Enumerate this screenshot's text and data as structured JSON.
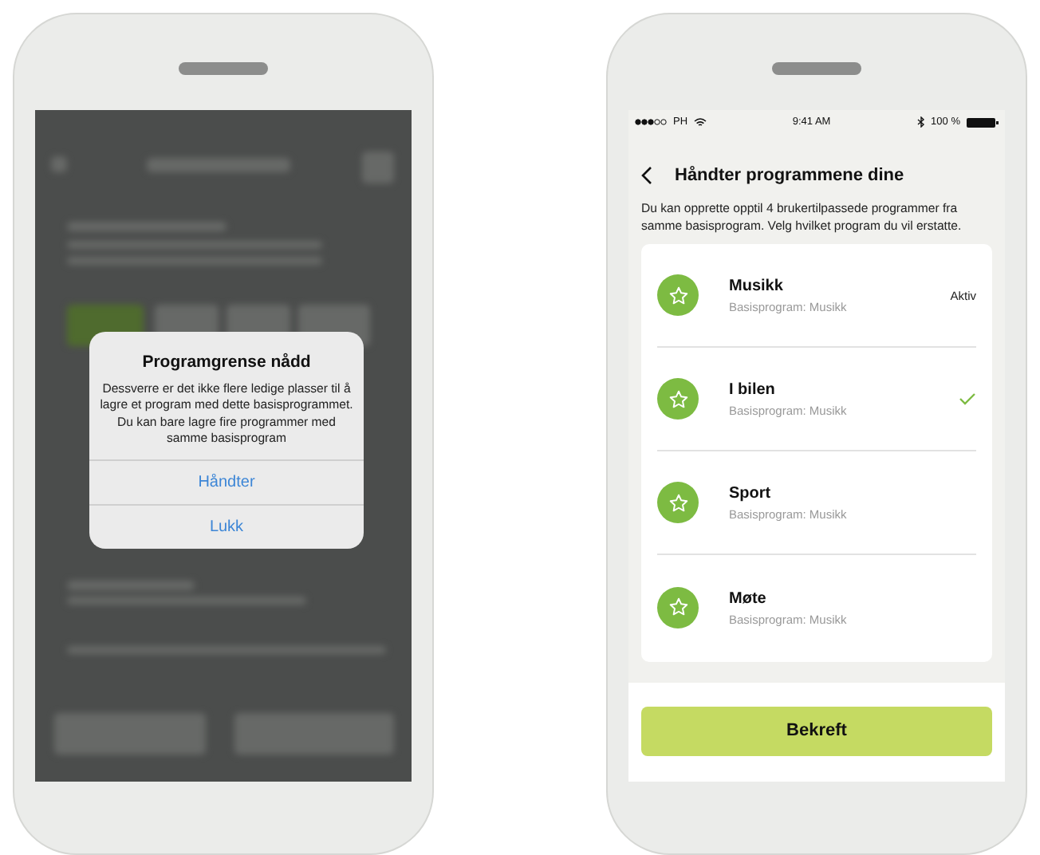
{
  "left_phone": {
    "dialog": {
      "title": "Programgrense nådd",
      "message": "Dessverre er det ikke flere ledige plasser til å lagre et program med dette basisprogrammet. Du kan bare lagre fire programmer med samme basisprogram",
      "buttons": [
        "Håndter",
        "Lukk"
      ]
    }
  },
  "right_phone": {
    "status_bar": {
      "carrier": "PH",
      "time": "9:41 AM",
      "battery": "100 %"
    },
    "title": "Håndter programmene dine",
    "description": "Du kan opprette opptil 4 brukertilpassede programmer fra samme basisprogram. Velg hvilket program du vil erstatte.",
    "programs": [
      {
        "name": "Musikk",
        "base": "Basisprogram: Musikk",
        "status": "Aktiv",
        "selected": false
      },
      {
        "name": "I bilen",
        "base": "Basisprogram: Musikk",
        "selected": true
      },
      {
        "name": "Sport",
        "base": "Basisprogram: Musikk",
        "selected": false
      },
      {
        "name": "Møte",
        "base": "Basisprogram: Musikk",
        "selected": false
      }
    ],
    "confirm_button": "Bekreft"
  }
}
